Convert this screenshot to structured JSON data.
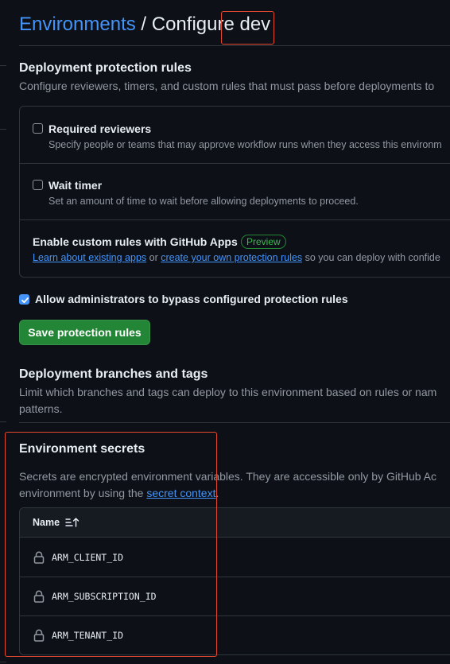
{
  "header": {
    "breadcrumb_root": "Environments",
    "separator": " / ",
    "configure_label": "Configure ",
    "environment_name": "dev"
  },
  "protection_rules": {
    "title": "Deployment protection rules",
    "description": "Configure reviewers, timers, and custom rules that must pass before deployments to",
    "required_reviewers": {
      "title": "Required reviewers",
      "description": "Specify people or teams that may approve workflow runs when they access this environm",
      "checked": false
    },
    "wait_timer": {
      "title": "Wait timer",
      "description": "Set an amount of time to wait before allowing deployments to proceed.",
      "checked": false
    },
    "custom_rules": {
      "title": "Enable custom rules with GitHub Apps",
      "badge": "Preview",
      "link1": "Learn about existing apps",
      "text_or": " or ",
      "link2": "create your own protection rules",
      "text_after": " so you can deploy with confide"
    },
    "admin_bypass": {
      "label": "Allow administrators to bypass configured protection rules",
      "checked": true
    },
    "save_button": "Save protection rules"
  },
  "branches": {
    "title": "Deployment branches and tags",
    "description_line1": "Limit which branches and tags can deploy to this environment based on rules or nam",
    "description_line2": "patterns."
  },
  "secrets": {
    "title": "Environment secrets",
    "description_line1": "Secrets are encrypted environment variables. They are accessible only by GitHub Ac",
    "description_line2_prefix": "environment by using the ",
    "description_link": "secret context",
    "description_line2_suffix": ".",
    "column_name": "Name",
    "rows": [
      {
        "name": "ARM_CLIENT_ID",
        "icon": "lock-icon"
      },
      {
        "name": "ARM_SUBSCRIPTION_ID",
        "icon": "lock-icon"
      },
      {
        "name": "ARM_TENANT_ID",
        "icon": "lock-icon"
      }
    ]
  },
  "colors": {
    "background": "#0d1117",
    "link": "#4493f8",
    "primary_button": "#238636",
    "annotation": "#e5482f"
  }
}
